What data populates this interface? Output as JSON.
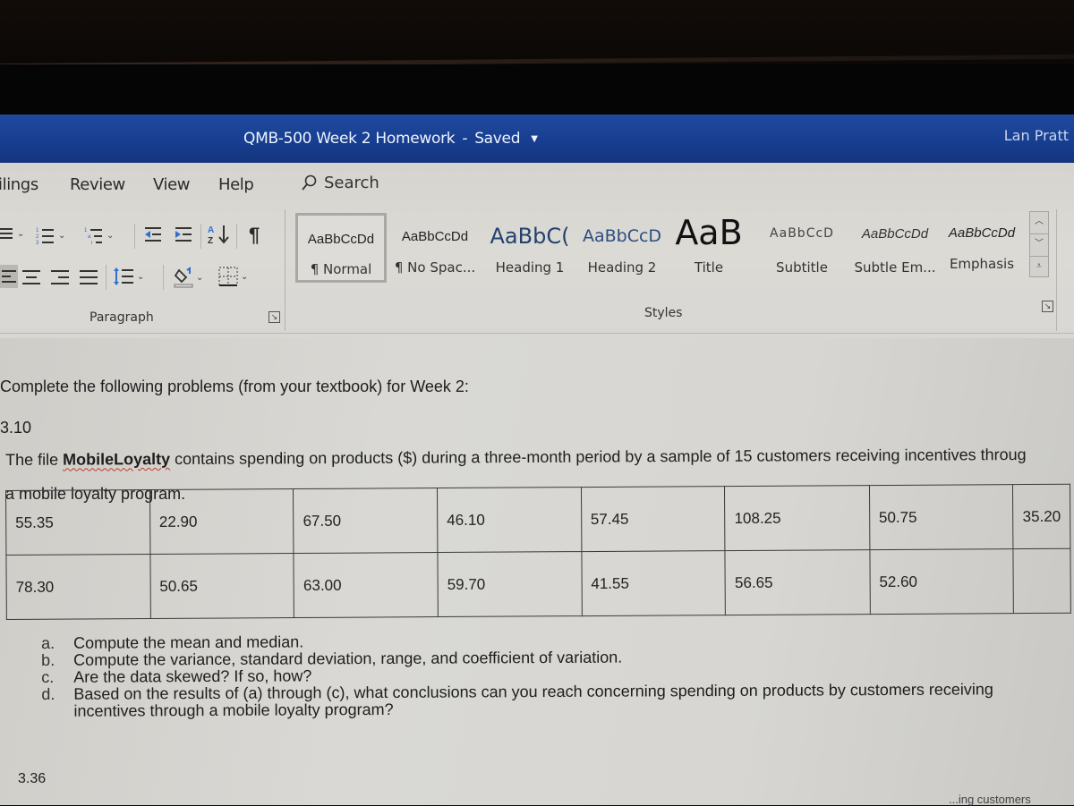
{
  "window": {
    "document_title": "QMB-500 Week 2 Homework",
    "separator": "-",
    "save_status": "Saved",
    "user_name": "Lan Pratt"
  },
  "ribbon": {
    "tabs": [
      {
        "label": "ilings"
      },
      {
        "label": "Review"
      },
      {
        "label": "View"
      },
      {
        "label": "Help"
      }
    ],
    "search_label": "Search",
    "paragraph_group_label": "Paragraph",
    "styles_group_label": "Styles",
    "paragraph_icons": [
      "bullets-icon",
      "numbering-icon",
      "multilevel-list-icon",
      "decrease-indent-icon",
      "increase-indent-icon",
      "sort-icon",
      "show-formatting-marks-icon",
      "align-left-icon",
      "align-center-icon",
      "align-right-icon",
      "justify-icon",
      "line-spacing-icon",
      "shading-icon",
      "borders-icon"
    ],
    "styles": [
      {
        "sample": "AaBbCcDd",
        "name": "¶ Normal",
        "selected": true
      },
      {
        "sample": "AaBbCcDd",
        "name": "¶ No Spac..."
      },
      {
        "sample": "AaBbC(",
        "name": "Heading 1"
      },
      {
        "sample": "AaBbCcD",
        "name": "Heading 2"
      },
      {
        "sample": "AaB",
        "name": "Title"
      },
      {
        "sample": "AaBbCcD",
        "name": "Subtitle"
      },
      {
        "sample": "AaBbCcDd",
        "name": "Subtle Em..."
      },
      {
        "sample": "AaBbCcDd",
        "name": "Emphasis"
      }
    ],
    "accent_color": "#1f4aa0"
  },
  "document": {
    "intro": "Complete the following problems (from your textbook) for Week 2:",
    "problem_number": "3.10",
    "problem_text_pre": "The file ",
    "problem_file": "MobileLoyalty",
    "problem_text_post": " contains spending on products ($) during a three-month period by a sample of 15 customers receiving incentives throug",
    "problem_text_line2": "a mobile loyalty program.",
    "table": {
      "rows": [
        [
          "55.35",
          "22.90",
          "67.50",
          "46.10",
          "57.45",
          "108.25",
          "50.75",
          "35.20"
        ],
        [
          "78.30",
          "50.65",
          "63.00",
          "59.70",
          "41.55",
          "56.65",
          "52.60",
          ""
        ]
      ]
    },
    "questions": [
      {
        "letter": "a.",
        "text": "Compute the mean and median."
      },
      {
        "letter": "b.",
        "text": "Compute the variance, standard deviation, range, and coefficient of variation."
      },
      {
        "letter": "c.",
        "text": "Are the data skewed? If so, how?"
      },
      {
        "letter": "d.",
        "text": "Based on the results of (a) through (c), what conclusions can you reach concerning spending on products by customers receiving"
      },
      {
        "letter": "",
        "text": "incentives through a mobile loyalty program?"
      }
    ],
    "next_problem_number": "3.36",
    "cut_off_fragment": "...ing customers"
  }
}
